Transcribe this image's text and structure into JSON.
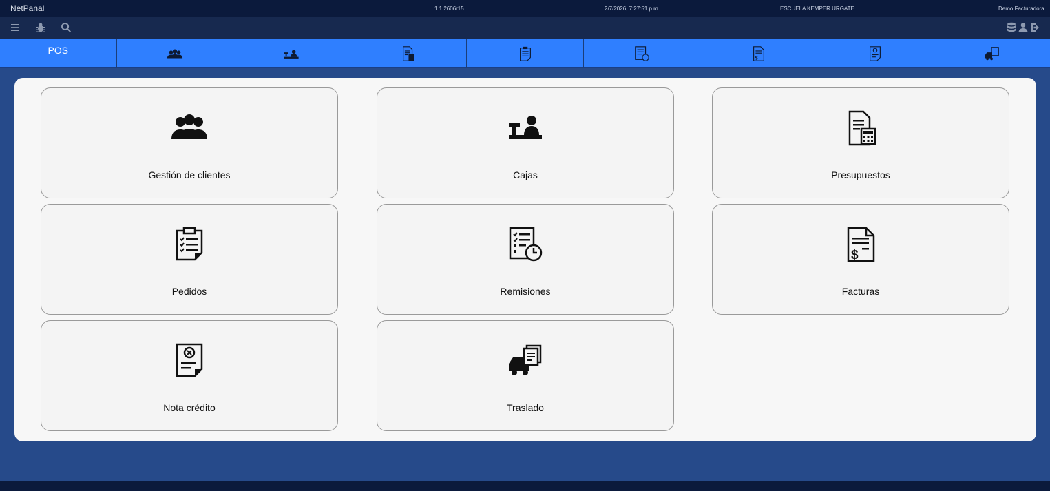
{
  "status": {
    "app_name": "NetPanal",
    "version": "1.1.2606r15",
    "datetime": "2/7/2026, 7:27:51 p.m.",
    "school": "ESCUELA KEMPER URGATE",
    "user": "Demo Facturadora"
  },
  "tabs": [
    {
      "label": "POS",
      "icon": "pos"
    },
    {
      "label": "",
      "icon": "clients-icon"
    },
    {
      "label": "",
      "icon": "cashier-icon"
    },
    {
      "label": "",
      "icon": "budget-icon"
    },
    {
      "label": "",
      "icon": "orders-icon"
    },
    {
      "label": "",
      "icon": "remissions-icon"
    },
    {
      "label": "",
      "icon": "invoice-icon"
    },
    {
      "label": "",
      "icon": "credit-note-icon"
    },
    {
      "label": "",
      "icon": "transfer-icon"
    }
  ],
  "cards": [
    {
      "label": "Gestión de clientes",
      "icon": "clients-icon"
    },
    {
      "label": "Cajas",
      "icon": "cashier-icon"
    },
    {
      "label": "Presupuestos",
      "icon": "budget-icon"
    },
    {
      "label": "Pedidos",
      "icon": "orders-icon"
    },
    {
      "label": "Remisiones",
      "icon": "remissions-icon"
    },
    {
      "label": "Facturas",
      "icon": "invoice-icon"
    },
    {
      "label": "Nota crédito",
      "icon": "credit-note-icon"
    },
    {
      "label": "Traslado",
      "icon": "transfer-icon"
    }
  ],
  "colors": {
    "tab_bar": "#2f7fff",
    "background": "#264a8a",
    "header": "#0b1a3c"
  }
}
